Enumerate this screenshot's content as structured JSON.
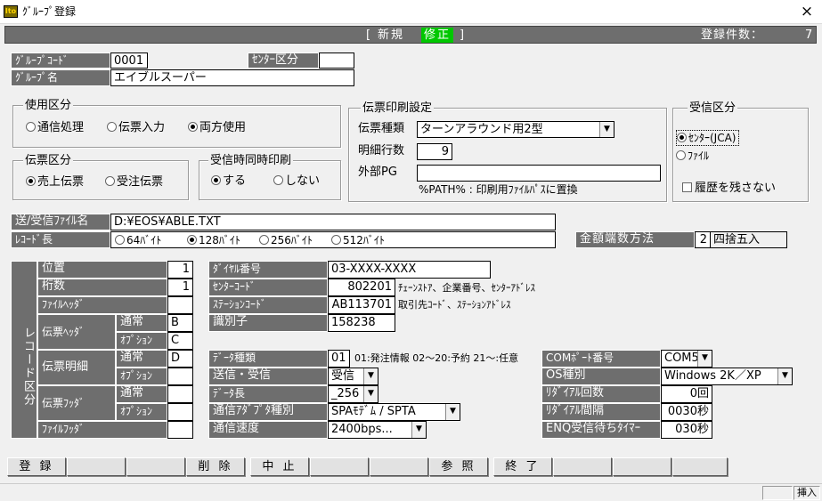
{
  "window": {
    "title": "ｸﾞﾙｰﾌﾟ登録",
    "close": "×",
    "icon_text": "Ito"
  },
  "header": {
    "mode_open": "[",
    "mode_new": "新規",
    "mode_edit": "修正",
    "mode_close": "]",
    "count_label": "登録件数：",
    "count_value": "7"
  },
  "group": {
    "code_label": "ｸﾞﾙｰﾌﾟｺｰﾄﾞ",
    "code_value": "0001",
    "center_label": "ｾﾝﾀｰ区分",
    "center_value": "",
    "name_label": "ｸﾞﾙｰﾌﾟ名",
    "name_value": "エイブルスーパー"
  },
  "usage": {
    "title": "使用区分",
    "options": [
      "通信処理",
      "伝票入力",
      "両方使用"
    ],
    "selected": 2
  },
  "slip_type": {
    "title": "伝票区分",
    "options": [
      "売上伝票",
      "受注伝票"
    ],
    "selected": 0
  },
  "receive_print": {
    "title": "受信時同時印刷",
    "options": [
      "する",
      "しない"
    ],
    "selected": 0
  },
  "print_settings": {
    "title": "伝票印刷設定",
    "kind_label": "伝票種類",
    "kind_value": "ターンアラウンド用2型",
    "lines_label": "明細行数",
    "lines_value": "9",
    "external_label": "外部PG",
    "external_value": "",
    "note": "%PATH% : 印刷用ﾌｧｲﾙﾊﾟｽに置換"
  },
  "receive_type": {
    "title": "受信区分",
    "options": [
      "ｾﾝﾀｰ(JCA)",
      "ﾌｧｲﾙ"
    ],
    "selected": 0,
    "keep_history_label": "履歴を残さない",
    "keep_history_checked": false
  },
  "file": {
    "label": "送/受信ﾌｧｲﾙ名",
    "value": "D:¥EOS¥ABLE.TXT",
    "record_label": "ﾚｺｰﾄﾞ長",
    "record_options": [
      "64ﾊﾞｲﾄ",
      "128ﾊﾞｲﾄ",
      "256ﾊﾞｲﾄ",
      "512ﾊﾞｲﾄ"
    ],
    "record_selected": 1
  },
  "rounding": {
    "label": "金額端数方法",
    "value": "2",
    "text": "四捨五入"
  },
  "record_section": {
    "title": "レコード区分",
    "position_label": "位置",
    "position_value": "1",
    "digits_label": "桁数",
    "digits_value": "1",
    "file_header_label": "ﾌｧｲﾙﾍｯﾀﾞ",
    "file_header_value": "",
    "slip_header_label": "伝票ﾍｯﾀﾞ",
    "slip_detail_label": "伝票明細",
    "slip_footer_label": "伝票ﾌｯﾀﾞ",
    "normal_label": "通常",
    "option_label": "ｵﾌﾟｼｮﾝ",
    "slip_header_normal": "B",
    "slip_header_option": "C",
    "slip_detail_normal": "D",
    "slip_detail_option": "",
    "slip_footer_normal": "",
    "slip_footer_option": "",
    "file_footer_label": "ﾌｧｲﾙﾌｯﾀﾞ",
    "file_footer_value": ""
  },
  "dial": {
    "dial_label": "ﾀﾞｲﾔﾙ番号",
    "dial_value": "03-XXXX-XXXX",
    "center_code_label": "ｾﾝﾀｰｺｰﾄﾞ",
    "center_code_value": "802201",
    "center_code_note": "ﾁｪｰﾝｽﾄｱ、企業番号、ｾﾝﾀｰｱﾄﾞﾚｽ",
    "station_label": "ｽﾃｰｼｮﾝｺｰﾄﾞ",
    "station_value": "AB113701",
    "station_note": "取引先ｺｰﾄﾞ、ｽﾃｰｼｮﾝｱﾄﾞﾚｽ",
    "id_label": "識別子",
    "id_value": "158238"
  },
  "comm": {
    "data_type_label": "ﾃﾞｰﾀ種類",
    "data_type_value": "01",
    "data_type_note": "01:発注情報 02～20:予約 21～:任意",
    "send_recv_label": "送信・受信",
    "send_recv_value": "受信",
    "data_len_label": "ﾃﾞｰﾀ長",
    "data_len_value": "_256",
    "adapter_label": "通信ｱﾀﾞﾌﾟﾀ種別",
    "adapter_value": "SPAﾓﾃﾞﾑ / SPTA",
    "speed_label": "通信速度",
    "speed_value": "2400bps..."
  },
  "port": {
    "com_label": "COMﾎﾟｰﾄ番号",
    "com_value": "COM5",
    "os_label": "OS種別",
    "os_value": "Windows 2K／XP",
    "redial_count_label": "ﾘﾀﾞｲｱﾙ回数",
    "redial_count_value": "0",
    "redial_count_unit": "回",
    "redial_interval_label": "ﾘﾀﾞｲｱﾙ間隔",
    "redial_interval_value": "0030",
    "redial_interval_unit": "秒",
    "enq_label": "ENQ受信待ちﾀｲﾏｰ",
    "enq_value": "030",
    "enq_unit": "秒"
  },
  "buttons": {
    "register": "登 録",
    "delete": "削 除",
    "cancel": "中 止",
    "reference": "参 照",
    "exit": "終 了"
  },
  "status": {
    "insert": "挿入"
  },
  "colors": {
    "header_bg": "#6e6e6e",
    "edit_highlight": "#00c800",
    "label_bg": "#6e6e6e"
  }
}
